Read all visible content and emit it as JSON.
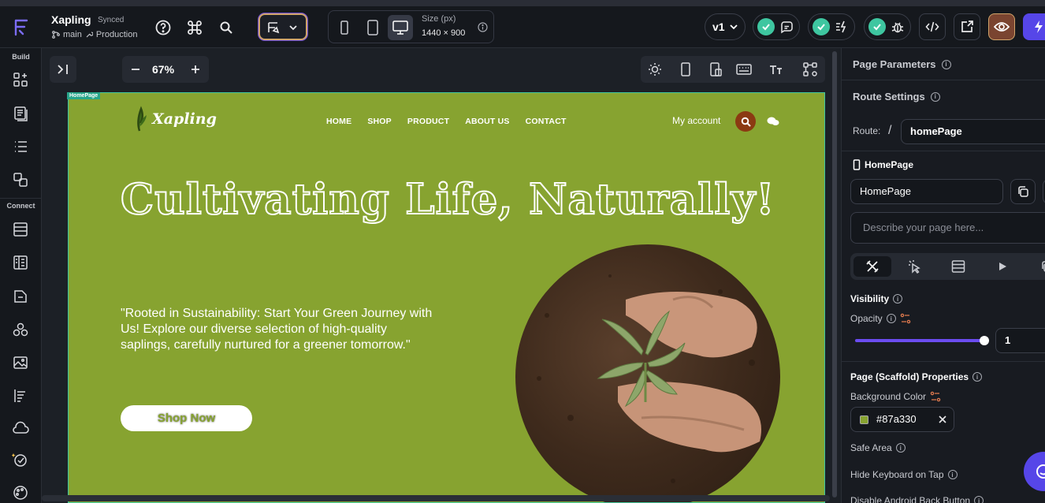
{
  "topbar": {
    "project_name": "Xapling",
    "sync_status": "Synced",
    "branch": "main",
    "environment": "Production",
    "size_label": "Size (px)",
    "size_value": "1440 × 900",
    "version": "v1"
  },
  "leftbar": {
    "section_build": "Build",
    "section_connect": "Connect"
  },
  "canvas": {
    "zoom": "67%",
    "page_tag": "HomePage"
  },
  "preview": {
    "brand": "Xapling",
    "nav": [
      "HOME",
      "SHOP",
      "PRODUCT",
      "ABOUT US",
      "CONTACT"
    ],
    "account": "My account",
    "headline": "Cultivating Life, Naturally!",
    "body": "\"Rooted in Sustainability: Start Your Green Journey with Us! Explore our diverse selection of high-quality saplings, carefully nurtured for a greener tomorrow.\"",
    "cta": "Shop Now"
  },
  "panel": {
    "page_parameters": "Page Parameters",
    "route_settings": "Route Settings",
    "route_label": "Route:",
    "route_slash": "/",
    "route_value": "homePage",
    "page_header": "HomePage",
    "page_name_value": "HomePage",
    "describe_placeholder": "Describe your page here...",
    "visibility": "Visibility",
    "opacity": "Opacity",
    "opacity_value": "1",
    "opacity_fraction": 1.0,
    "scaffold": "Page (Scaffold) Properties",
    "bg_color_label": "Background Color",
    "bg_color_value": "#87a330",
    "safe_area": "Safe Area",
    "hide_keyboard": "Hide Keyboard on Tap",
    "disable_back": "Disable Android Back Button"
  },
  "colors": {
    "accent": "#6b4cf0",
    "success": "#3ec6a0",
    "page_bg": "#87a330",
    "search_badge": "#8b3a12"
  }
}
